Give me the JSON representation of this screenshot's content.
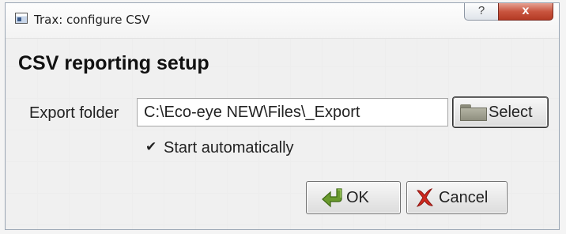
{
  "window": {
    "title": "Trax: configure CSV",
    "help_glyph": "?",
    "close_glyph": "x"
  },
  "form": {
    "heading": "CSV reporting setup",
    "export_folder_label": "Export folder",
    "export_folder_value": "C:\\Eco-eye NEW\\Files\\_Export",
    "select_label": "Select",
    "auto_start_label": "Start automatically",
    "auto_start_checked": true
  },
  "buttons": {
    "ok_label": "OK",
    "cancel_label": "Cancel"
  },
  "icons": {
    "app": "app-window-icon",
    "folder": "folder-icon",
    "ok": "green-arrow-icon",
    "cancel": "red-x-icon"
  }
}
